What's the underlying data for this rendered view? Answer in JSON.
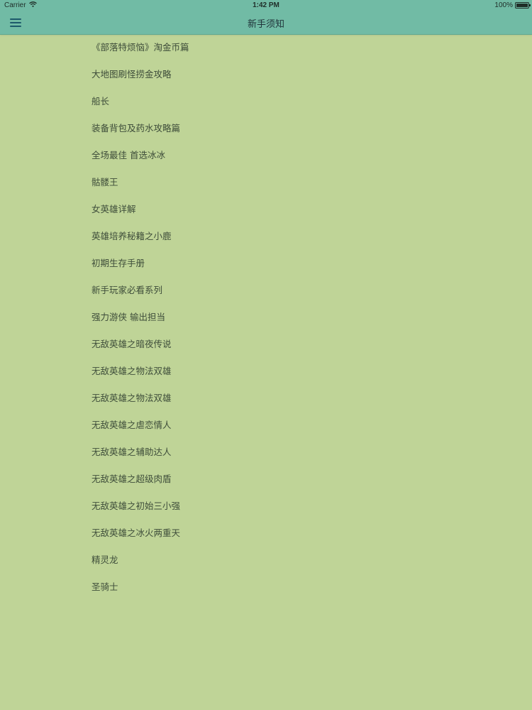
{
  "status_bar": {
    "carrier": "Carrier",
    "time": "1:42 PM",
    "battery": "100%"
  },
  "nav": {
    "title": "新手须知",
    "menu_icon": "hamburger-menu-icon"
  },
  "colors": {
    "header": "#71bba5",
    "background": "#bfd497",
    "text": "#3e4d3a"
  },
  "articles": [
    {
      "title": "《部落特烦恼》淘金币篇"
    },
    {
      "title": "大地图刷怪捞金攻略"
    },
    {
      "title": "船长"
    },
    {
      "title": "装备背包及药水攻略篇"
    },
    {
      "title": "全场最佳 首选冰冰"
    },
    {
      "title": "骷髅王"
    },
    {
      "title": "女英雄详解"
    },
    {
      "title": "英雄培养秘籍之小鹿"
    },
    {
      "title": "初期生存手册"
    },
    {
      "title": "新手玩家必看系列"
    },
    {
      "title": "强力游侠 输出担当"
    },
    {
      "title": "无敌英雄之暗夜传说"
    },
    {
      "title": "无敌英雄之物法双雄"
    },
    {
      "title": "无敌英雄之物法双雄"
    },
    {
      "title": "无敌英雄之虐恋情人"
    },
    {
      "title": "无敌英雄之辅助达人"
    },
    {
      "title": "无敌英雄之超级肉盾"
    },
    {
      "title": "无敌英雄之初始三小强"
    },
    {
      "title": "无敌英雄之冰火两重天"
    },
    {
      "title": "精灵龙"
    },
    {
      "title": "圣骑士"
    }
  ]
}
